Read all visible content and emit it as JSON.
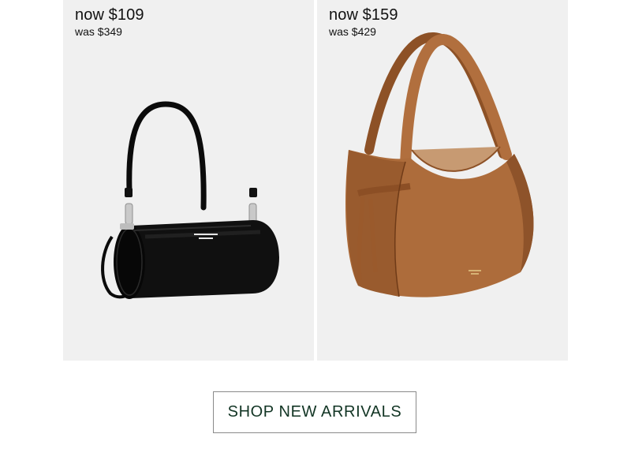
{
  "products": [
    {
      "now_price": "now $109",
      "was_price": "was $349",
      "bag_color": "#0e0e0e",
      "icon": "black-barrel-crossbody-bag"
    },
    {
      "now_price": "now $159",
      "was_price": "was $429",
      "bag_color": "#a8683a",
      "icon": "tan-leather-hobo-bag"
    }
  ],
  "cta": {
    "label": "SHOP NEW ARRIVALS",
    "text_color": "#123524"
  },
  "colors": {
    "card_background": "#f0f0f0",
    "cta_border": "#8a8a8a"
  }
}
